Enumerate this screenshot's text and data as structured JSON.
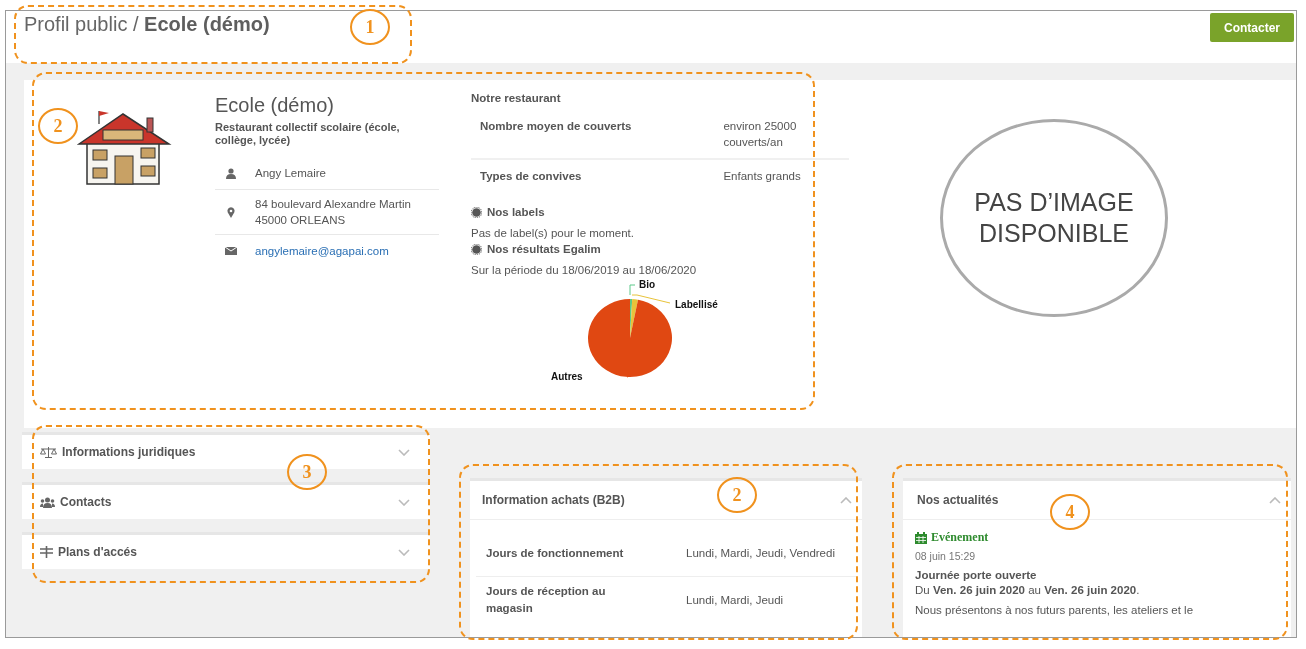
{
  "header": {
    "breadcrumb": "Profil public / ",
    "title": "Ecole (démo)",
    "contact_button": "Contacter"
  },
  "profile": {
    "name": "Ecole (démo)",
    "category": "Restaurant collectif scolaire (école, collège, lycée)",
    "contacts": [
      {
        "kind": "person",
        "text": "Angy Lemaire"
      },
      {
        "kind": "address",
        "text": "84 boulevard Alexandre Martin 45000 ORLEANS"
      },
      {
        "kind": "email",
        "text": "angylemaire@agapai.com"
      }
    ]
  },
  "restaurant": {
    "heading": "Notre restaurant",
    "rows": [
      {
        "label": "Nombre moyen de couverts",
        "value": "environ 25000 couverts/an"
      },
      {
        "label": "Types de convives",
        "value": "Enfants grands"
      }
    ],
    "labels_heading": "Nos labels",
    "labels_text": "Pas de label(s) pour le moment.",
    "egalim_heading": "Nos résultats Egalim",
    "period": "Sur la période du 18/06/2019 au 18/06/2020",
    "pie_labels": [
      {
        "label": "Bio",
        "color": "#5cc98a"
      },
      {
        "label": "Labellisé",
        "color": "#e8c33a"
      },
      {
        "label": "Autres",
        "color": "#e04812"
      }
    ]
  },
  "no_image": "PAS D’IMAGE DISPONIBLE",
  "accordions": [
    {
      "kind": "scale",
      "label": "Informations juridiques",
      "expanded": false
    },
    {
      "kind": "people",
      "label": "Contacts",
      "expanded": false
    },
    {
      "kind": "signpost",
      "label": "Plans d'accés",
      "expanded": false
    }
  ],
  "purchasing": {
    "title": "Information achats (B2B)",
    "expanded": true,
    "rows": [
      {
        "label": "Jours de fonctionnement",
        "value": "Lundi, Mardi, Jeudi, Vendredi"
      },
      {
        "label": "Jours de réception au magasin",
        "value": "Lundi, Mardi, Jeudi"
      }
    ]
  },
  "news": {
    "title": "Nos actualités",
    "expanded": true,
    "items": [
      {
        "type": "Evénement",
        "date": "08 juin 15:29",
        "title": "Journée porte ouverte",
        "dates": "Du **Ven. 26 juin 2020** au **Ven. 26 juin 2020**.",
        "text": "Nous présentons à nos futurs parents, les ateliers et le"
      }
    ]
  },
  "callouts": [
    {
      "number": "1"
    },
    {
      "number": "2"
    },
    {
      "number": "3"
    },
    {
      "number": "2"
    },
    {
      "number": "4"
    }
  ]
}
